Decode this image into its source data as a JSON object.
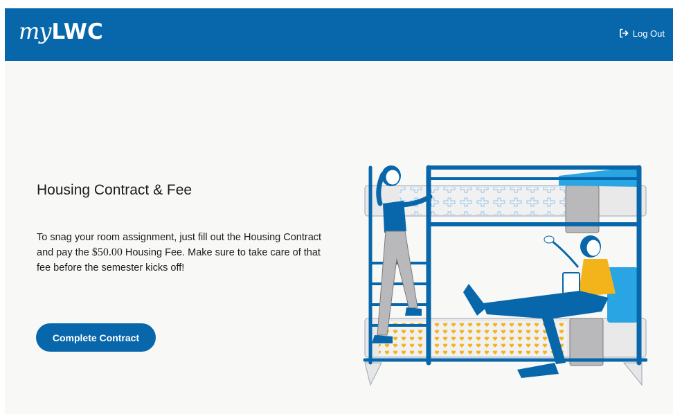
{
  "header": {
    "logo_my": "my",
    "logo_lwc": "LWC",
    "logout_label": "Log Out"
  },
  "main": {
    "title": "Housing Contract & Fee",
    "description_part1": "To snag your room assignment, just fill out the Housing Contract and pay the ",
    "fee_amount": "$50.00",
    "description_part2": " Housing Fee. Make sure to take care of that fee before the semester kicks off!",
    "cta_label": "Complete Contract"
  },
  "colors": {
    "brand_blue": "#0867aa",
    "background": "#f8f8f7",
    "accent_yellow": "#f3b41b"
  }
}
